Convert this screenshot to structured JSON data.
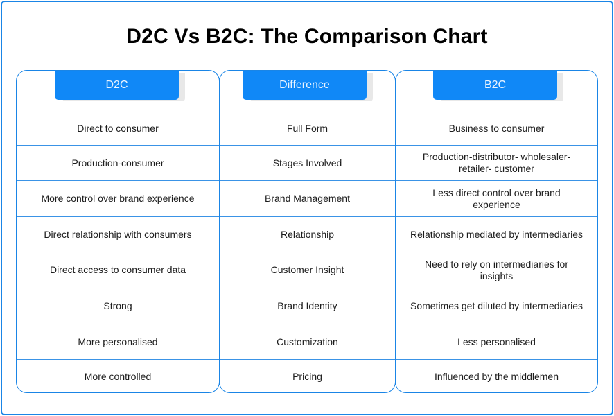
{
  "title": "D2C Vs B2C: The Comparison Chart",
  "columns": {
    "d2c": {
      "header": "D2C",
      "rows": [
        "Direct to consumer",
        "Production-consumer",
        "More control over brand experience",
        "Direct relationship with consumers",
        "Direct access to consumer data",
        "Strong",
        "More personalised",
        "More controlled"
      ]
    },
    "difference": {
      "header": "Difference",
      "rows": [
        "Full Form",
        "Stages Involved",
        "Brand Management",
        "Relationship",
        "Customer Insight",
        "Brand Identity",
        "Customization",
        "Pricing"
      ]
    },
    "b2c": {
      "header": "B2C",
      "rows": [
        "Business to consumer",
        "Production-distributor- wholesaler-retailer- customer",
        "Less direct control over brand experience",
        "Relationship mediated by intermediaries",
        "Need to rely on intermediaries for insights",
        "Sometimes get diluted by intermediaries",
        "Less personalised",
        "Influenced by the middlemen"
      ]
    }
  },
  "colors": {
    "accent": "#1088f7",
    "border": "#1a85e6",
    "text": "#1c1c1c"
  }
}
